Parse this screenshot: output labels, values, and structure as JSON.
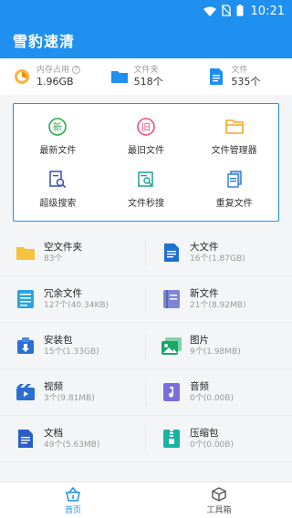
{
  "status_bar": {
    "time": "10:21"
  },
  "header": {
    "title": "雪豹速清"
  },
  "stats": [
    {
      "label": "内存占用",
      "value": "1.96GB",
      "icon": "memory-gauge-icon",
      "help": "?"
    },
    {
      "label": "文件夹",
      "value": "518个",
      "icon": "folder-icon"
    },
    {
      "label": "文件",
      "value": "535个",
      "icon": "file-icon"
    }
  ],
  "quick": [
    {
      "label": "最新文件",
      "icon": "new-file-icon",
      "glyph": "新"
    },
    {
      "label": "最旧文件",
      "icon": "old-file-icon",
      "glyph": "旧"
    },
    {
      "label": "文件管理器",
      "icon": "folder-manager-icon"
    },
    {
      "label": "超级搜索",
      "icon": "super-search-icon"
    },
    {
      "label": "文件秒搜",
      "icon": "quick-search-icon"
    },
    {
      "label": "重复文件",
      "icon": "duplicate-file-icon"
    }
  ],
  "categories": [
    {
      "name": "空文件夹",
      "info": "83个",
      "icon": "empty-folder-icon"
    },
    {
      "name": "大文件",
      "info": "16个(1.87GB)",
      "icon": "large-file-icon"
    },
    {
      "name": "冗余文件",
      "info": "127个(40.34KB)",
      "icon": "redundant-file-icon"
    },
    {
      "name": "新文件",
      "info": "21个(8.92MB)",
      "icon": "new-doc-icon"
    },
    {
      "name": "安装包",
      "info": "15个(1.33GB)",
      "icon": "apk-icon"
    },
    {
      "name": "图片",
      "info": "9个(1.98MB)",
      "icon": "image-icon"
    },
    {
      "name": "视频",
      "info": "3个(9.81MB)",
      "icon": "video-icon"
    },
    {
      "name": "音频",
      "info": "0个(0.00B)",
      "icon": "audio-icon"
    },
    {
      "name": "文档",
      "info": "49个(5.63MB)",
      "icon": "document-icon"
    },
    {
      "name": "压缩包",
      "info": "0个(0.00B)",
      "icon": "archive-icon"
    }
  ],
  "bottom_nav": [
    {
      "label": "首页",
      "icon": "home-basket-icon",
      "active": true
    },
    {
      "label": "工具箱",
      "icon": "toolbox-icon",
      "active": false
    }
  ],
  "colors": {
    "primary": "#1f8ff0",
    "background": "#f4f5f7"
  }
}
